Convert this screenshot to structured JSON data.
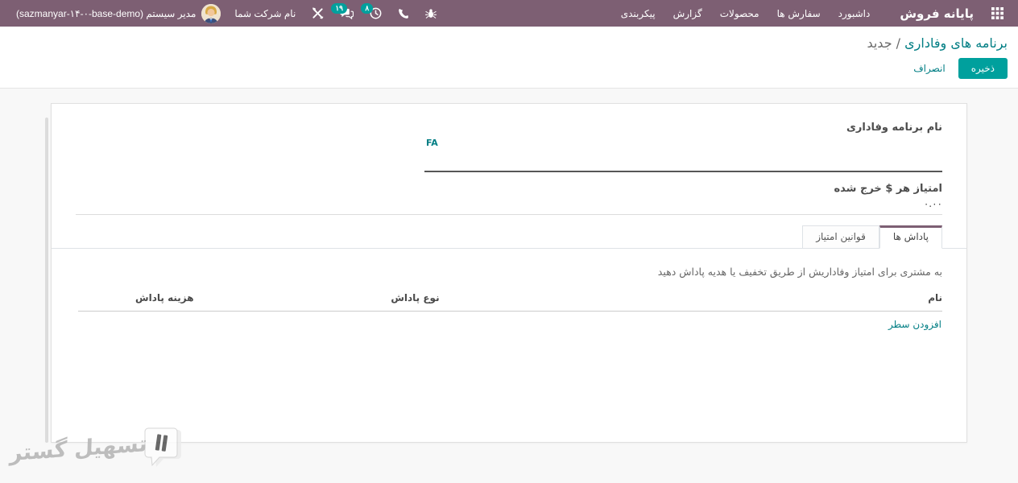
{
  "colors": {
    "topbar": "#7d5f73",
    "accent": "#00a09d",
    "link": "#017e84"
  },
  "topbar": {
    "app_title": "پایانه فروش",
    "menus": [
      "داشبورد",
      "سفارش ها",
      "محصولات",
      "گزارش",
      "پیکربندی"
    ],
    "systray": {
      "company": "نام شرکت شما",
      "user": "مدیر سیستم (sazmanyar-۱۴-۰-base-demo)",
      "chat_badge": "۱۹",
      "activity_badge": "۸"
    }
  },
  "breadcrumb": {
    "parent": "برنامه های وفاداری",
    "separator": " / ",
    "current": "جدید"
  },
  "actions": {
    "save": "ذخیره",
    "discard": "انصراف"
  },
  "form": {
    "name_label": "نام برنامه وفاداری",
    "translate_tag": "FA",
    "points_label": "امتیاز هر $ خرج شده",
    "points_value": "۰.۰۰",
    "tabs": [
      {
        "label": "پاداش ها",
        "active": true
      },
      {
        "label": "قوانین امتیاز",
        "active": false
      }
    ],
    "rewards": {
      "description": "به مشتری برای امتیاز وفاداریش از طریق تخفیف یا هدیه پاداش دهید",
      "columns": [
        "نام",
        "نوع پاداش",
        "هزینه پاداش"
      ],
      "rows": [],
      "add_line": "افزودن سطر"
    }
  },
  "watermark": {
    "text": "تسهیل گستر"
  }
}
